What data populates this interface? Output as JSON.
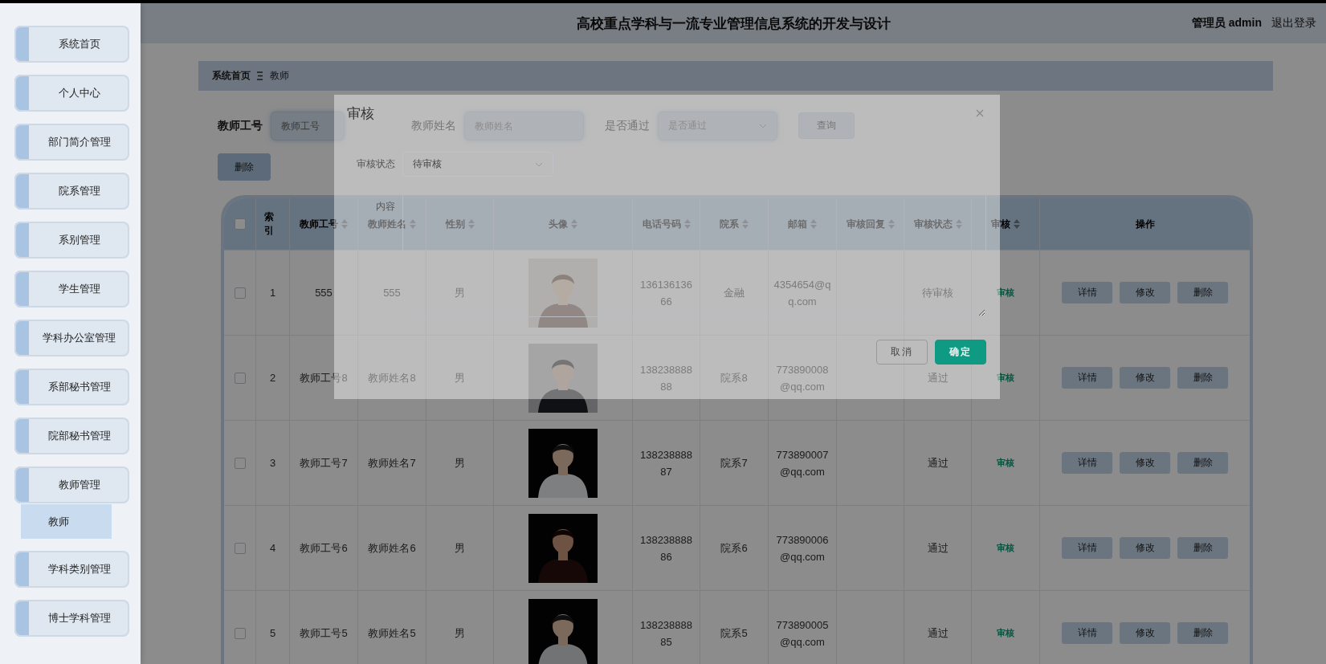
{
  "header": {
    "title": "高校重点学科与一流专业管理信息系统的开发与设计",
    "user": "管理员 admin",
    "logout": "退出登录"
  },
  "sidebar": {
    "items": [
      {
        "label": "系统首页"
      },
      {
        "label": "个人中心"
      },
      {
        "label": "部门简介管理"
      },
      {
        "label": "院系管理"
      },
      {
        "label": "系别管理"
      },
      {
        "label": "学生管理"
      },
      {
        "label": "学科办公室管理"
      },
      {
        "label": "系部秘书管理"
      },
      {
        "label": "院部秘书管理"
      },
      {
        "label": "教师管理",
        "children": [
          {
            "label": "教师",
            "selected": true
          }
        ]
      },
      {
        "label": "学科类别管理"
      },
      {
        "label": "博士学科管理"
      }
    ]
  },
  "breadcrumb": [
    "系统首页",
    "教师"
  ],
  "search": {
    "fields": [
      {
        "kind": "input",
        "label": "教师工号",
        "placeholder": "教师工号"
      },
      {
        "kind": "input",
        "label": "教师姓名",
        "placeholder": "教师姓名"
      },
      {
        "kind": "select",
        "label": "是否通过",
        "placeholder": "是否通过"
      }
    ],
    "button": "查询"
  },
  "delete_button": "删除",
  "table": {
    "select_all_checked": false,
    "columns": [
      {
        "label": "索引",
        "sortable": false
      },
      {
        "label": "教师工号",
        "sortable": true
      },
      {
        "label": "教师姓名",
        "sortable": true
      },
      {
        "label": "性别",
        "sortable": true
      },
      {
        "label": "头像",
        "sortable": true
      },
      {
        "label": "电话号码",
        "sortable": true
      },
      {
        "label": "院系",
        "sortable": true
      },
      {
        "label": "邮箱",
        "sortable": true
      },
      {
        "label": "审核回复",
        "sortable": true
      },
      {
        "label": "审核状态",
        "sortable": true
      },
      {
        "label": "审核",
        "sortable": true
      },
      {
        "label": "操作",
        "sortable": false
      }
    ],
    "rows": [
      {
        "checked": false,
        "index": "1",
        "teacher_no": "555",
        "teacher_name": "555",
        "gender": "男",
        "phone": "13613613666",
        "department": "金融",
        "email": "4354654@qq.com",
        "review_status": "待审核",
        "review_link": "审核",
        "actions": [
          "详情",
          "修改",
          "删除"
        ]
      },
      {
        "checked": false,
        "index": "2",
        "teacher_no": "教师工号8",
        "teacher_name": "教师姓名8",
        "gender": "男",
        "phone": "13823888888",
        "department": "院系8",
        "email": "773890008@qq.com",
        "review_status": "通过",
        "review_link": "审核",
        "actions": [
          "详情",
          "修改",
          "删除"
        ]
      },
      {
        "checked": false,
        "index": "3",
        "teacher_no": "教师工号7",
        "teacher_name": "教师姓名7",
        "gender": "男",
        "phone": "13823888887",
        "department": "院系7",
        "email": "773890007@qq.com",
        "review_status": "通过",
        "review_link": "审核",
        "actions": [
          "详情",
          "修改",
          "删除"
        ]
      },
      {
        "checked": false,
        "index": "4",
        "teacher_no": "教师工号6",
        "teacher_name": "教师姓名6",
        "gender": "男",
        "phone": "13823888886",
        "department": "院系6",
        "email": "773890006@qq.com",
        "review_status": "通过",
        "review_link": "审核",
        "actions": [
          "详情",
          "修改",
          "删除"
        ]
      },
      {
        "checked": false,
        "index": "5",
        "teacher_no": "教师工号5",
        "teacher_name": "教师姓名5",
        "gender": "男",
        "phone": "13823888885",
        "department": "院系5",
        "email": "773890005@qq.com",
        "review_status": "通过",
        "review_link": "审核",
        "actions": [
          "详情",
          "修改",
          "删除"
        ]
      }
    ]
  },
  "review_dialog": {
    "title": "审核",
    "status_label": "审核状态",
    "status_value": "待审核",
    "content_label": "内容",
    "buttons": [
      {
        "kind": "default",
        "label": "取消"
      },
      {
        "kind": "primary",
        "label": "确定"
      }
    ]
  }
}
